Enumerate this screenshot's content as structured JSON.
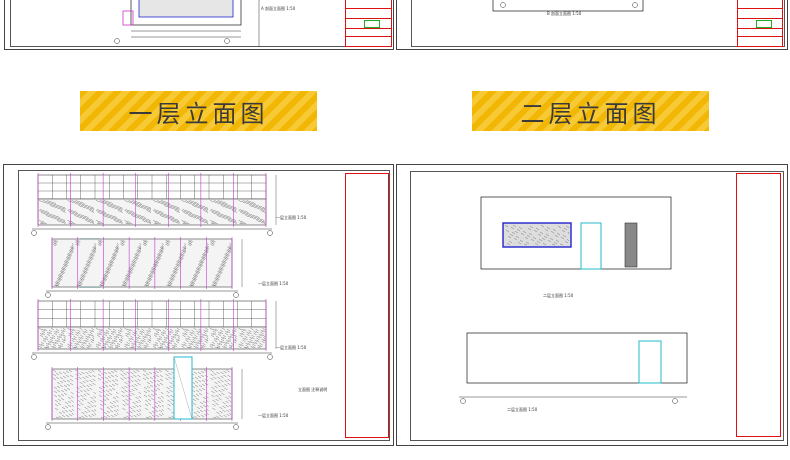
{
  "banners": {
    "floor1": "一层立面图",
    "floor2": "二层立面图"
  },
  "drawing_labels": {
    "top_left": "A 剖面立面图 1:50",
    "top_right": "B 剖面立面图 1:50",
    "f1_e1": "一层立面图 1:50",
    "f1_e2": "一层立面图 1:50",
    "f1_e3": "一层立面图 1:50",
    "f1_e4": "一层立面图 1:50",
    "f1_note": "立面图 注释说明",
    "f2_e1": "二层立面图 1:50",
    "f2_e2": "二层立面图 1:50"
  },
  "colors": {
    "grid": "#444444",
    "magenta": "#cc33cc",
    "red": "#dd1111",
    "blue": "#2222cc",
    "cyan": "#22bbcc",
    "green": "#22aa22",
    "banner": "#f2b705"
  }
}
